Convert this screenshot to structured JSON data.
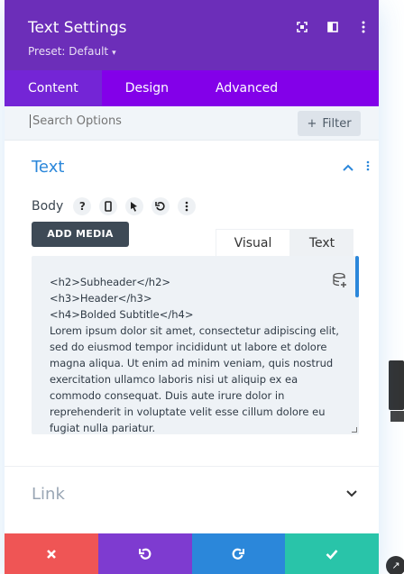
{
  "header": {
    "title": "Text Settings",
    "preset": "Preset: Default",
    "icons": [
      "fullscreen-icon",
      "split-view-icon",
      "more-icon"
    ]
  },
  "tabs": [
    {
      "label": "Content",
      "active": true
    },
    {
      "label": "Design",
      "active": false
    },
    {
      "label": "Advanced",
      "active": false
    }
  ],
  "search": {
    "placeholder": "Search Options",
    "filter_label": "Filter"
  },
  "text_section": {
    "title": "Text",
    "body_label": "Body",
    "add_media_label": "ADD MEDIA",
    "editor_tabs": [
      {
        "label": "Visual",
        "active": false
      },
      {
        "label": "Text",
        "active": true
      }
    ],
    "editor_content": "<h2>Subheader</h2>\n<h3>Header</h3>\n<h4>Bolded Subtitle</h4>\nLorem ipsum dolor sit amet, consectetur adipiscing elit, sed do eiusmod tempor incididunt ut labore et dolore magna aliqua. Ut enim ad minim veniam, quis nostrud exercitation ullamco laboris nisi ut aliquip ex ea commodo consequat. Duis aute irure dolor in reprehenderit in voluptate velit esse cillum dolore eu fugiat nulla pariatur."
  },
  "link_section": {
    "title": "Link"
  },
  "colors": {
    "header": "#6c2eb9",
    "tabs": "#8300e9",
    "accent": "#2b87da",
    "cancel": "#ef5555",
    "undo": "#7e3bd0",
    "redo": "#2b87da",
    "save": "#29c4a9"
  }
}
